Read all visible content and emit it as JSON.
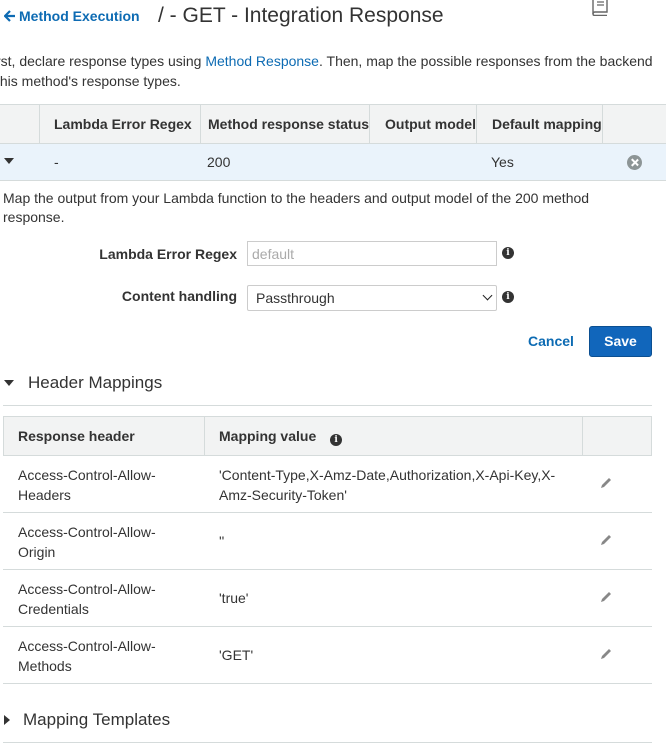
{
  "header": {
    "back_label": "Method Execution",
    "title": "/ - GET - Integration Response"
  },
  "intro": {
    "text_before": "rst, declare response types using ",
    "link": "Method Response",
    "text_after": ". Then, map the possible responses from the backend",
    "line2": " this method's response types."
  },
  "response_table": {
    "columns": [
      "Lambda Error Regex",
      "Method response status",
      "Output model",
      "Default mapping"
    ],
    "row": {
      "regex": "-",
      "status": "200",
      "output_model": "",
      "default_mapping": "Yes"
    }
  },
  "detail": {
    "description": "Map the output from your Lambda function to the headers and output model of the 200 method response.",
    "regex_label": "Lambda Error Regex",
    "regex_placeholder": "default",
    "content_label": "Content handling",
    "content_value": "Passthrough",
    "cancel_label": "Cancel",
    "save_label": "Save"
  },
  "header_mappings": {
    "title": "Header Mappings",
    "columns": [
      "Response header",
      "Mapping value"
    ],
    "rows": [
      {
        "header": "Access-Control-Allow-Headers",
        "value": "'Content-Type,X-Amz-Date,Authorization,X-Api-Key,X-Amz-Security-Token'"
      },
      {
        "header": "Access-Control-Allow-Origin",
        "value": "''"
      },
      {
        "header": "Access-Control-Allow-Credentials",
        "value": "'true'"
      },
      {
        "header": "Access-Control-Allow-Methods",
        "value": "'GET'"
      }
    ]
  },
  "mapping_templates": {
    "title": "Mapping Templates"
  },
  "icons": {
    "back": "arrow-left-icon",
    "book": "book-icon",
    "remove": "remove-circle-icon",
    "info": "info-icon",
    "edit": "pencil-icon"
  },
  "colors": {
    "link": "#0d6bb3",
    "primary_button": "#1166bb",
    "selected_row": "#eaf3fb"
  }
}
